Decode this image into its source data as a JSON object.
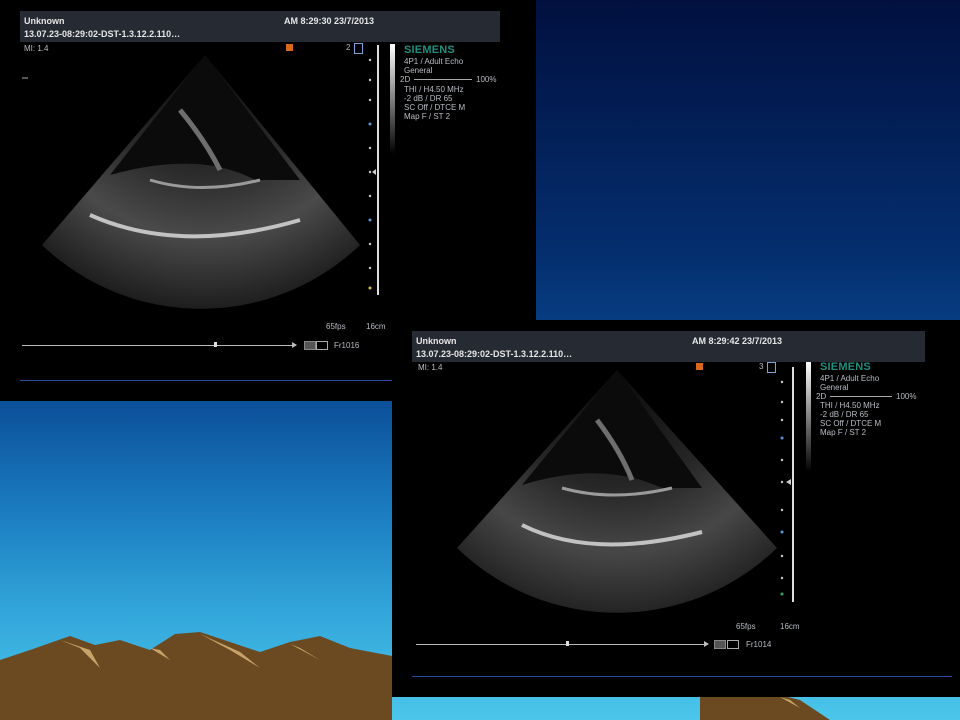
{
  "images": [
    {
      "patient": "Unknown",
      "time": "AM 8:29:30 23/7/2013",
      "study_id": "13.07.23-08:29:02-DST-1.3.12.2.110…",
      "mi": "MI:  1.4",
      "channel": "2",
      "brand": "SIEMENS",
      "probe": "4P1 / Adult Echo",
      "preset": "General",
      "mode": "2D",
      "zoom": "100%",
      "thi": "THI / H4.50 MHz",
      "gain": "-2 dB / DR 65",
      "sc": "SC Off / DTCE M",
      "map": "Map F / ST 2",
      "fps": "65fps",
      "depth": "16cm",
      "frame": "Fr1016"
    },
    {
      "patient": "Unknown",
      "time": "AM 8:29:42 23/7/2013",
      "study_id": "13.07.23-08:29:02-DST-1.3.12.2.110…",
      "mi": "MI:  1.4",
      "channel": "3",
      "brand": "SIEMENS",
      "probe": "4P1 / Adult Echo",
      "preset": "General",
      "mode": "2D",
      "zoom": "100%",
      "thi": "THI / H4.50 MHz",
      "gain": "-2 dB / DR 65",
      "sc": "SC Off / DTCE M",
      "map": "Map F / ST 2",
      "fps": "65fps",
      "depth": "16cm",
      "frame": "Fr1014"
    }
  ]
}
